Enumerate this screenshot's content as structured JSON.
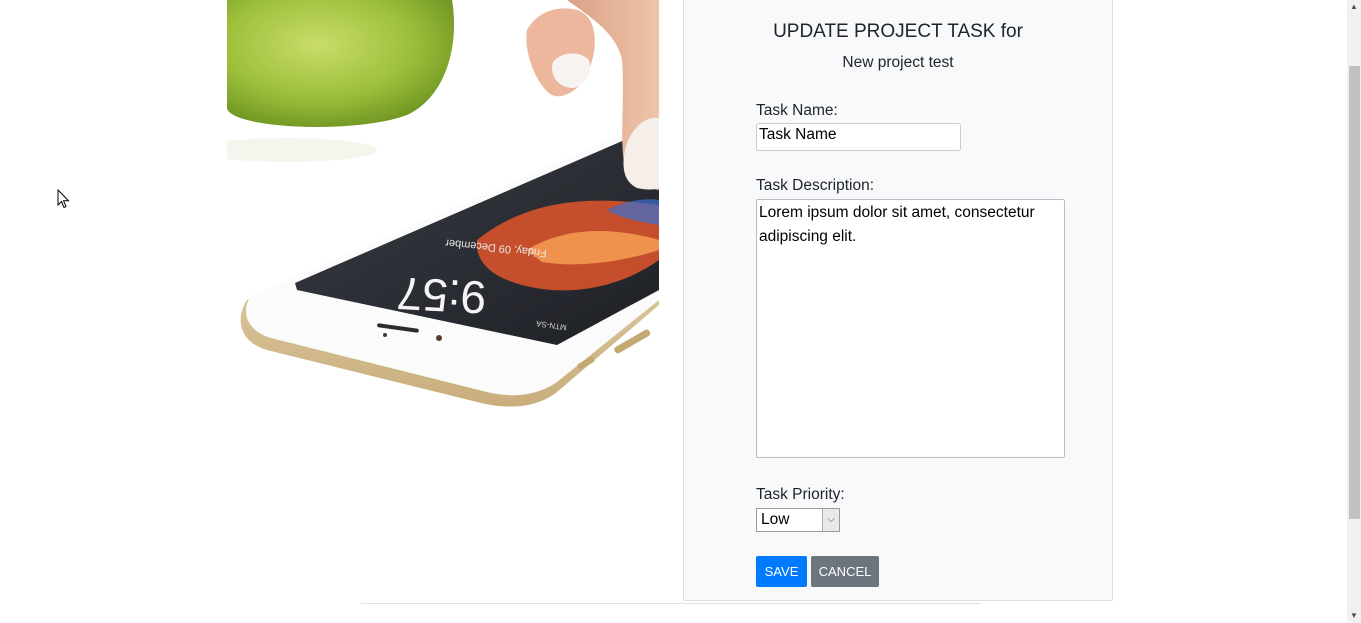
{
  "form": {
    "title": "UPDATE PROJECT TASK for",
    "subtitle": "New project test",
    "task_name_label": "Task Name:",
    "task_name_value": "Task Name",
    "task_description_label": "Task Description:",
    "task_description_value": "Lorem ipsum dolor sit amet, consectetur adipiscing elit.",
    "task_priority_label": "Task Priority:",
    "task_priority_value": "Low",
    "save_label": "SAVE",
    "cancel_label": "CANCEL"
  },
  "hero_image": {
    "phone_time": "9:57",
    "phone_date": "Friday, 09 December",
    "carrier": "MTN-SA"
  },
  "colors": {
    "primary": "#007bff",
    "secondary": "#6c757d",
    "card_bg": "#f8f9fa"
  }
}
